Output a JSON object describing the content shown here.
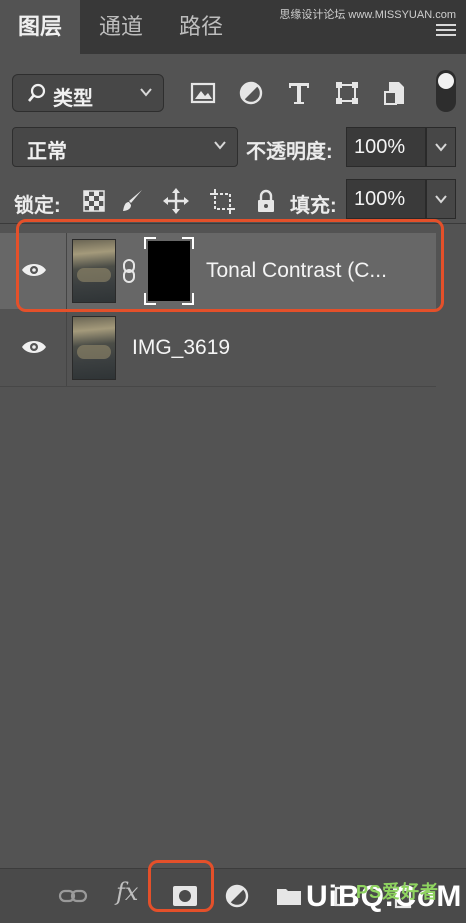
{
  "tabs": [
    {
      "label": "图层",
      "active": true
    },
    {
      "label": "通道",
      "active": false
    },
    {
      "label": "路径",
      "active": false
    }
  ],
  "watermark": "思缘设计论坛 www.MISSYUAN.com",
  "filter": {
    "label": "类型",
    "icons": [
      "image-filter-icon",
      "adjustment-filter-icon",
      "type-filter-icon",
      "shape-filter-icon",
      "smart-object-filter-icon"
    ]
  },
  "blend_mode": {
    "value": "正常"
  },
  "opacity": {
    "label": "不透明度:",
    "value": "100%"
  },
  "lock": {
    "label": "锁定:",
    "icons": [
      "lock-transparent-pixels-icon",
      "lock-image-pixels-icon",
      "lock-position-icon",
      "lock-artboard-icon",
      "lock-all-icon"
    ]
  },
  "fill": {
    "label": "填充:",
    "value": "100%"
  },
  "layers": [
    {
      "name": "Tonal Contrast (C...",
      "visible": true,
      "selected": true,
      "has_mask": true
    },
    {
      "name": "IMG_3619",
      "visible": true,
      "selected": false,
      "has_mask": false
    }
  ],
  "bottom_bar": {
    "fx_label": "fx",
    "icons": [
      "link-layers-icon",
      "layer-style-icon",
      "add-mask-icon",
      "adjustment-layer-icon",
      "group-folder-icon",
      "new-layer-icon",
      "trash-icon"
    ]
  },
  "logo": {
    "text": "UiBQ.CoM",
    "small": "PS爱好者"
  },
  "colors": {
    "highlight": "#e4502a",
    "panel": "#535353",
    "selected_row": "#676767"
  }
}
